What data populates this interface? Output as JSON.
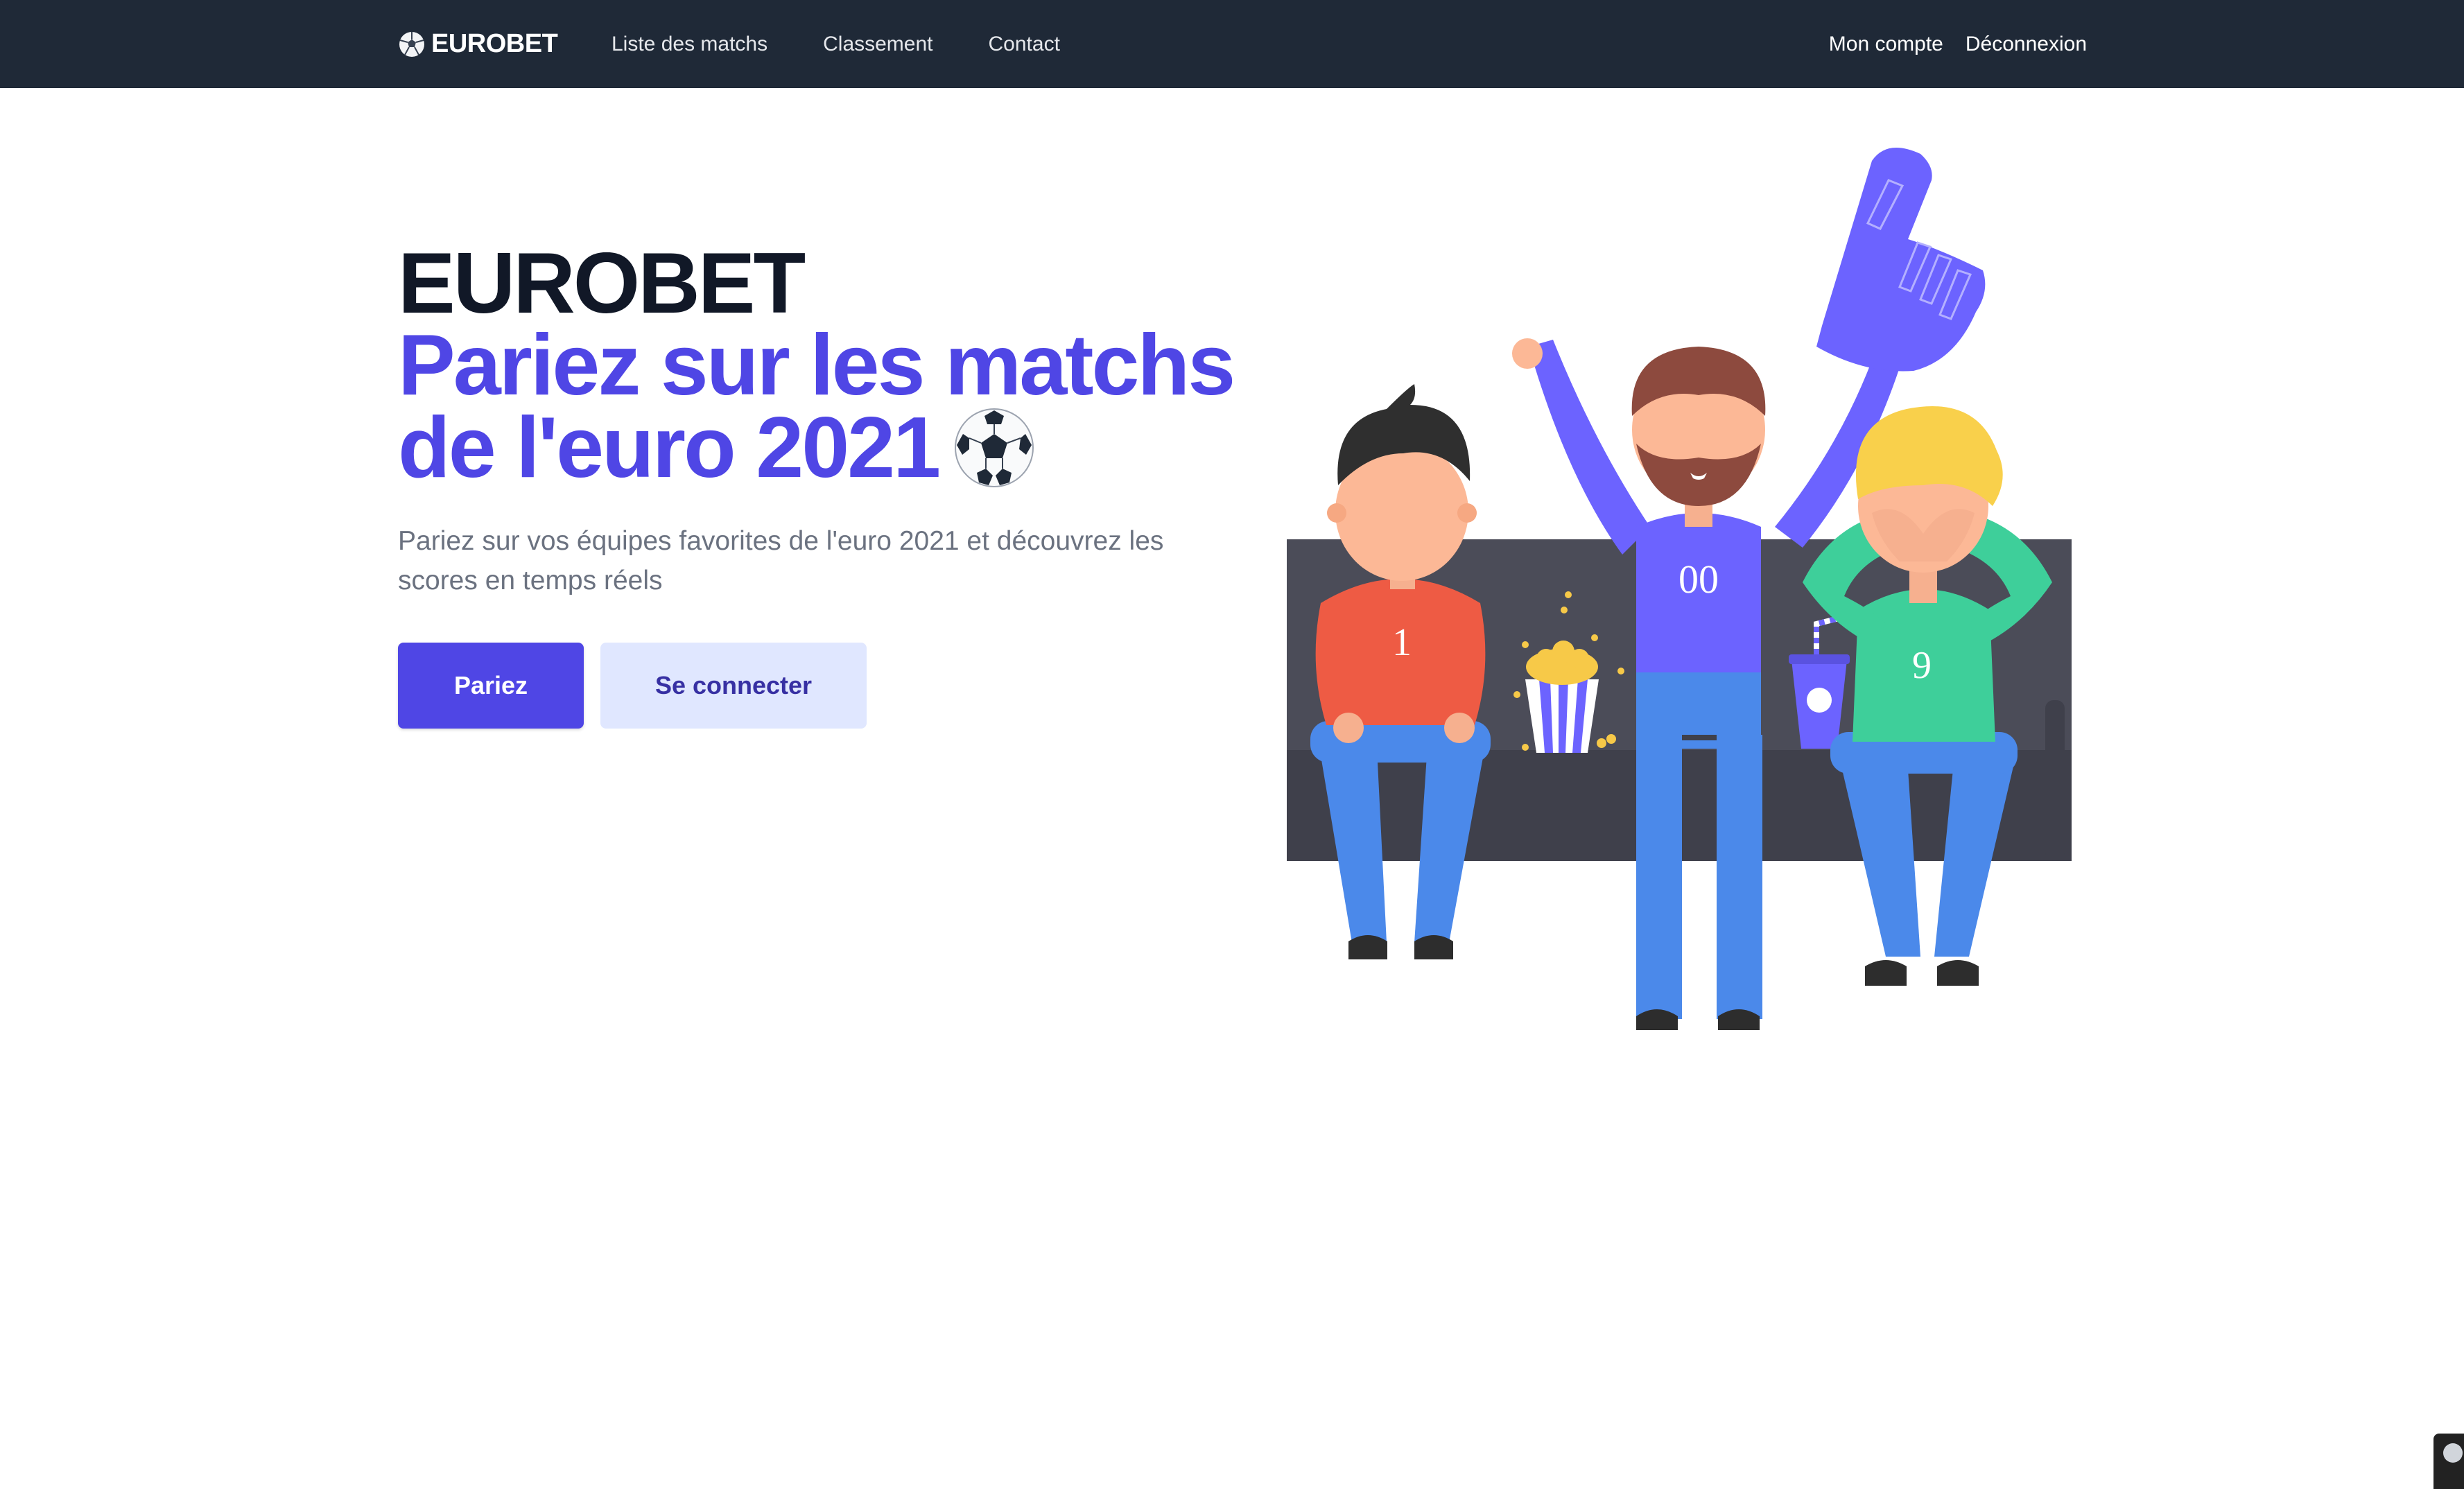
{
  "navbar": {
    "brand": "EUROBET",
    "brand_icon": "soccer-ball-icon",
    "links": [
      "Liste des matchs",
      "Classement",
      "Contact"
    ],
    "account": "Mon compte",
    "logout": "Déconnexion"
  },
  "hero": {
    "title_line1": "EUROBET",
    "title_line2": "Pariez sur les matchs",
    "title_line3": "de l'euro 2021",
    "title_emoji": "soccer-ball-icon",
    "subtitle": "Pariez sur vos équipes favorites de l'euro 2021 et découvrez les scores en temps réels",
    "primary_button": "Pariez",
    "secondary_button": "Se connecter"
  },
  "illustration": {
    "fan_left_number": "1",
    "fan_center_number": "00",
    "fan_right_number": "9"
  },
  "colors": {
    "navbar_bg": "#1f2937",
    "primary": "#4f46e5",
    "secondary_bg": "#e0e7ff",
    "title_dark": "#111827"
  }
}
